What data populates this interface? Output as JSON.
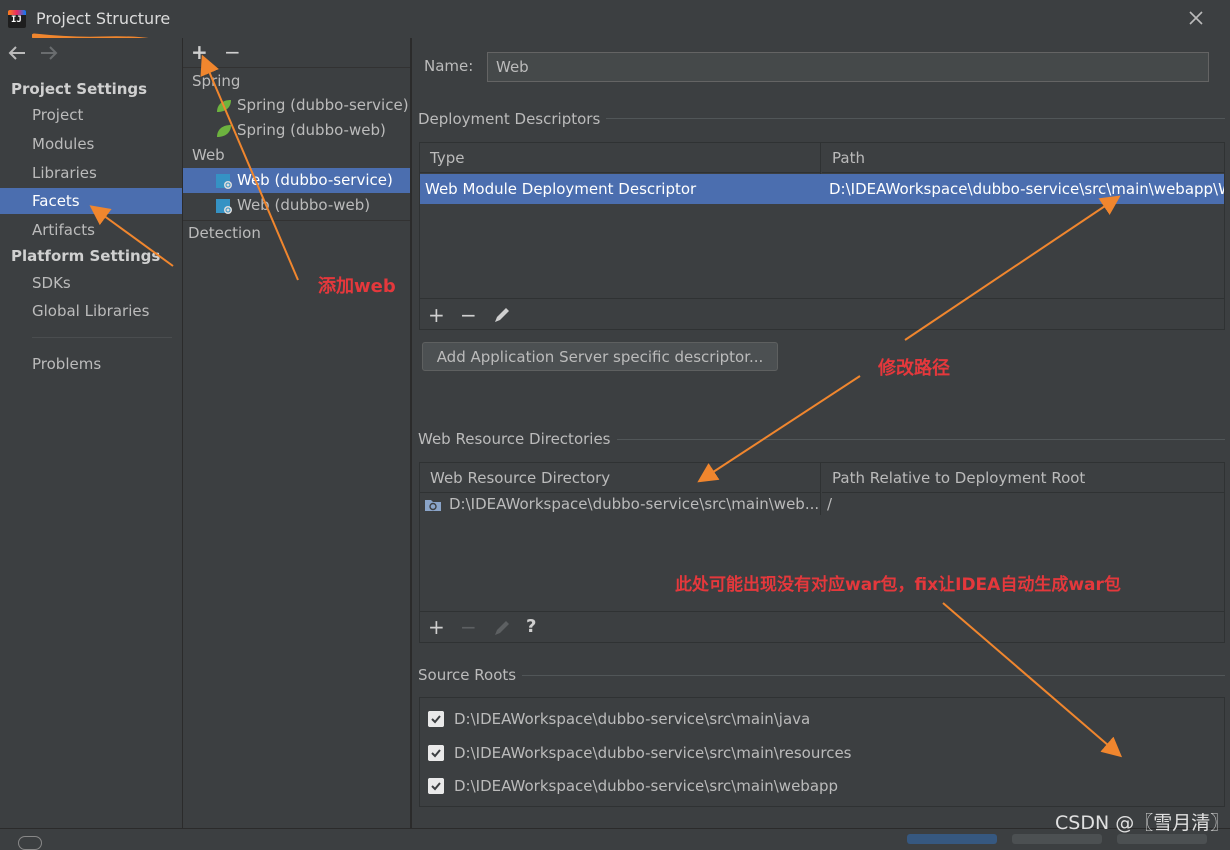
{
  "window": {
    "title": "Project Structure"
  },
  "nav": {
    "project_settings_header": "Project Settings",
    "project_items": [
      "Project",
      "Modules",
      "Libraries",
      "Facets",
      "Artifacts"
    ],
    "platform_settings_header": "Platform Settings",
    "platform_items": [
      "SDKs",
      "Global Libraries"
    ],
    "problems": "Problems",
    "selected": "Facets"
  },
  "tree": {
    "toolbar": {
      "add": "+",
      "remove": "−"
    },
    "spring_group": "Spring",
    "spring_items": [
      "Spring (dubbo-service)",
      "Spring (dubbo-web)"
    ],
    "web_group": "Web",
    "web_items": [
      "Web (dubbo-service)",
      "Web (dubbo-web)"
    ],
    "detection": "Detection",
    "selected": "Web (dubbo-service)"
  },
  "facet": {
    "name_label": "Name:",
    "name_value": "Web",
    "deployment": {
      "title": "Deployment Descriptors",
      "columns": [
        "Type",
        "Path"
      ],
      "rows": [
        {
          "type": "Web Module Deployment Descriptor",
          "path": "D:\\IDEAWorkspace\\dubbo-service\\src\\main\\webapp\\W"
        }
      ],
      "toolbar": {
        "add": "+",
        "remove": "−"
      },
      "add_server_button": "Add Application Server specific descriptor..."
    },
    "web_resources": {
      "title": "Web Resource Directories",
      "columns": [
        "Web Resource Directory",
        "Path Relative to Deployment Root"
      ],
      "rows": [
        {
          "directory": "D:\\IDEAWorkspace\\dubbo-service\\src\\main\\web...",
          "relative": "/"
        }
      ],
      "toolbar": {
        "add": "+",
        "remove": "−",
        "help": "?"
      }
    },
    "source_roots": {
      "title": "Source Roots",
      "items": [
        {
          "path": "D:\\IDEAWorkspace\\dubbo-service\\src\\main\\java",
          "checked": true
        },
        {
          "path": "D:\\IDEAWorkspace\\dubbo-service\\src\\main\\resources",
          "checked": true
        },
        {
          "path": "D:\\IDEAWorkspace\\dubbo-service\\src\\main\\webapp",
          "checked": true
        }
      ]
    }
  },
  "annotations": {
    "add_web": "添加web",
    "modify_path": "修改路径",
    "war_note": "此处可能出现没有对应war包，fix让IDEA自动生成war包"
  },
  "watermark": "CSDN @〖雪月清〗",
  "colors": {
    "background": "#3c3f41",
    "selection": "#4b6eaf",
    "annotation_text": "#e4383c",
    "annotation_arrow": "#f0862e"
  }
}
